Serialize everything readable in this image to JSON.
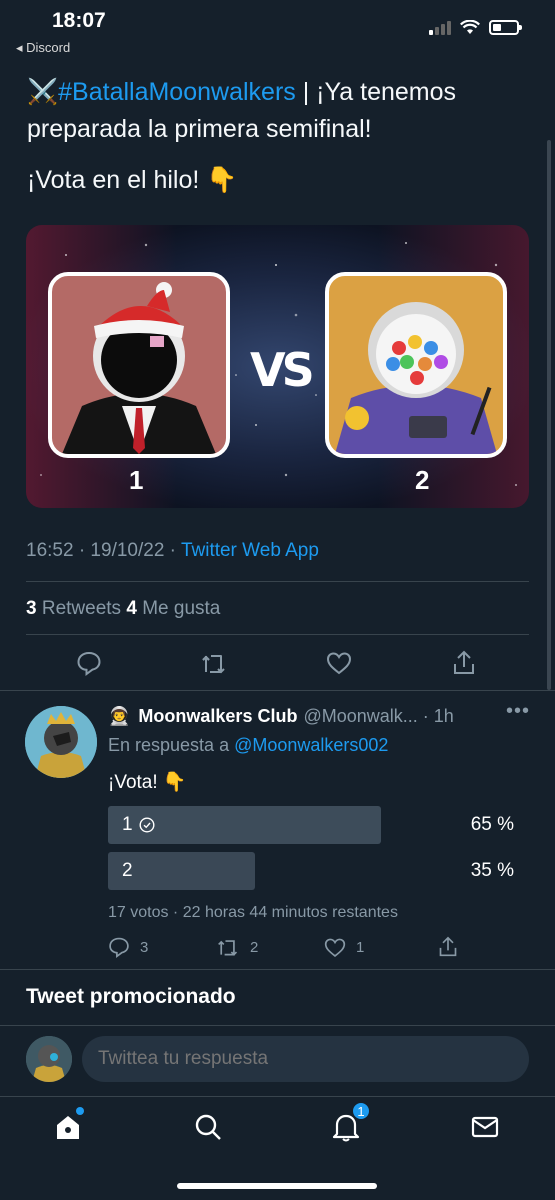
{
  "status_bar": {
    "time": "18:07",
    "back_app": "◂ Discord"
  },
  "tweet": {
    "emoji_prefix": "⚔️",
    "hashtag": "#BatallaMoonwalkers",
    "text_line1_rest": " | ¡Ya tenemos preparada la primera semifinal!",
    "text_line2": "¡Vota en el hilo! 👇",
    "media": {
      "vs_text": "VS",
      "left_number": "1",
      "right_number": "2"
    },
    "time": "16:52 · 19/10/22 · ",
    "source": "Twitter Web App",
    "retweets_count": "3",
    "retweets_label": " Retweets  ",
    "likes_count": "4",
    "likes_label": " Me gusta"
  },
  "reply": {
    "emoji": "👨‍🚀",
    "name": "Moonwalkers Club",
    "handle": "@Moonwalk... · 1h",
    "more": "•••",
    "reply_prefix": "En respuesta a ",
    "mention": "@Moonwalkers002",
    "text": "¡Vota! 👇",
    "poll": {
      "options": [
        {
          "label": "1",
          "percent_text": "65 %",
          "fraction": 0.65,
          "winner": true
        },
        {
          "label": "2",
          "percent_text": "35 %",
          "fraction": 0.35,
          "winner": false
        }
      ],
      "meta": "17 votos · 22 horas 44 minutos restantes"
    },
    "replies_count": "3",
    "retweets_count": "2",
    "likes_count": "1"
  },
  "promoted_title": "Tweet promocionado",
  "composer": {
    "placeholder": "Twittea tu respuesta"
  },
  "tabbar": {
    "notifications_badge": "1"
  },
  "colors": {
    "background": "#15202b",
    "accent": "#1d9bf0",
    "muted": "#8899a6",
    "divider": "#38444d"
  }
}
